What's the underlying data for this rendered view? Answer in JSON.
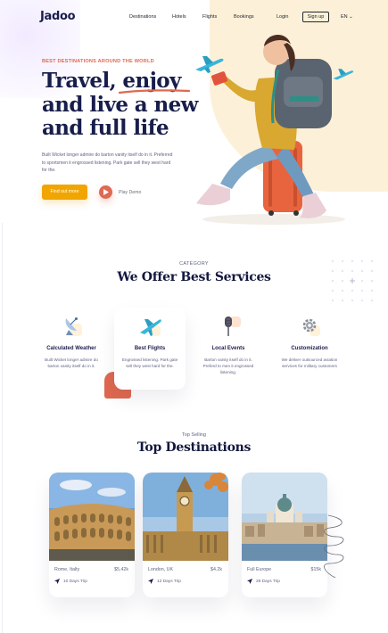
{
  "nav": {
    "logo": "Jadoo",
    "links": [
      "Destinations",
      "Hotels",
      "Flights",
      "Bookings"
    ],
    "login": "Login",
    "signup": "Sign up",
    "language": "EN ⌄"
  },
  "hero": {
    "eyebrow": "BEST DESTINATIONS AROUND THE WORLD",
    "headline": "Travel, enjoy and live a new and full life",
    "description": "Built Wicket longer admire do barton vanity itself do in it. Preferred to sportsmen it engrossed listening. Park gate sell they west hard for the.",
    "cta_label": "Find out more",
    "play_label": "Play Demo"
  },
  "services": {
    "category": "CATEGORY",
    "title": "We Offer Best Services",
    "items": [
      {
        "title": "Calculated Weather",
        "desc": "Built Wicket longer admire do barton vanity itself do in it.",
        "icon": "satellite-dish-icon"
      },
      {
        "title": "Best Flights",
        "desc": "Engrossed listening. Park gate sell they west hard for the.",
        "icon": "airplane-icon"
      },
      {
        "title": "Local Events",
        "desc": "Barton vanity itself do in it. Preferd to men it engrossed listening.",
        "icon": "microphone-icon"
      },
      {
        "title": "Customization",
        "desc": "We deliver outsourced aviation services for military customers",
        "icon": "gear-icon"
      }
    ]
  },
  "destinations": {
    "label": "Top Selling",
    "title": "Top Destinations",
    "items": [
      {
        "name": "Rome, Italty",
        "price": "$5,42k",
        "trip": "10 Days Trip"
      },
      {
        "name": "London, UK",
        "price": "$4.2k",
        "trip": "12 Days Trip"
      },
      {
        "name": "Full Europe",
        "price": "$15k",
        "trip": "28 Days Trip"
      }
    ]
  },
  "colors": {
    "accent_orange": "#df6951",
    "cta_yellow": "#f1a501",
    "navy": "#181e4b",
    "cream": "#fdf0d8"
  }
}
